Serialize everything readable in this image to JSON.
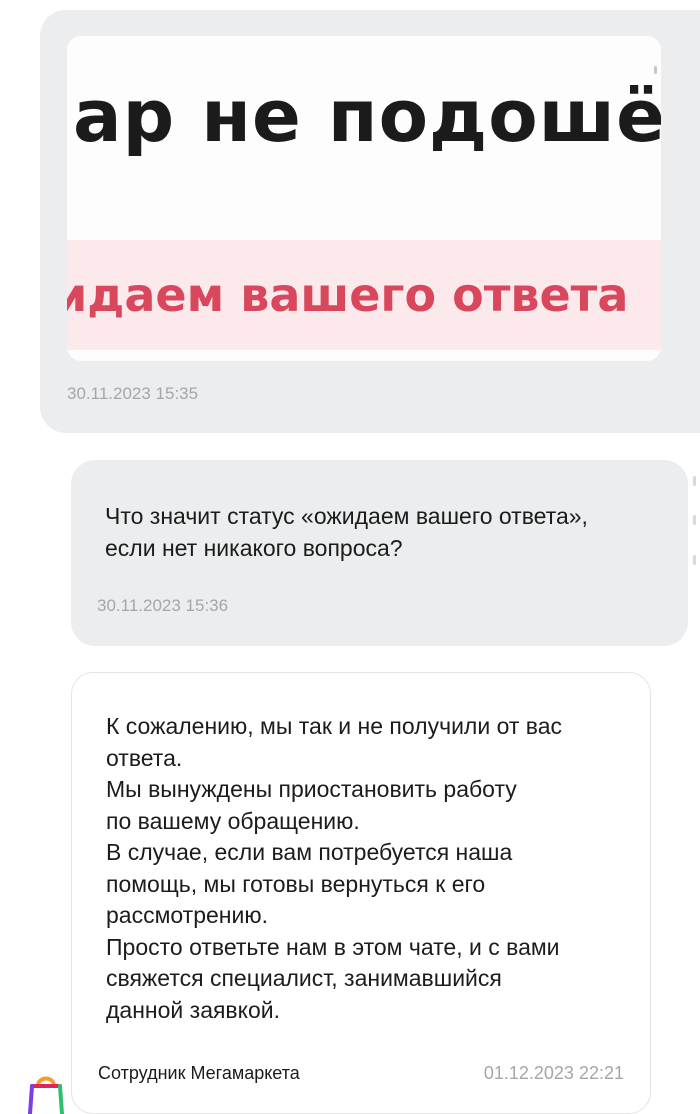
{
  "messages": {
    "image_message": {
      "attachment": {
        "top_text": "ар не подошё",
        "band_text": "идаем вашего ответа"
      },
      "time": "30.11.2023 15:35"
    },
    "question_message": {
      "lines": [
        "Что значит статус «ожидаем вашего ответа»,",
        "если нет никакого вопроса?"
      ],
      "time": "30.11.2023 15:36"
    },
    "reply_message": {
      "lines": [
        "К сожалению, мы так и не получили от вас",
        "ответа.",
        "Мы вынуждены приостановить работу",
        "по вашему обращению.",
        "В случае, если вам потребуется наша",
        "помощь, мы готовы вернуться к его",
        "рассмотрению.",
        "Просто ответьте нам в этом чате, и с вами",
        "свяжется специалист, занимавшийся",
        "данной заявкой."
      ],
      "sender": "Сотрудник Мегамаркета",
      "time": "01.12.2023 22:21"
    }
  },
  "avatar": {
    "icon": "shopping-bag-icon",
    "colors": [
      "#f39c33",
      "#e0245e",
      "#7b3fe4",
      "#2fbf71"
    ]
  },
  "colors": {
    "outgoing_bubble": "#ebedee",
    "incoming_border": "#e2e4e6",
    "timestamp": "#a3a7ac",
    "attachment_band": "#fbe9ec",
    "attachment_band_text": "#d9475d"
  }
}
